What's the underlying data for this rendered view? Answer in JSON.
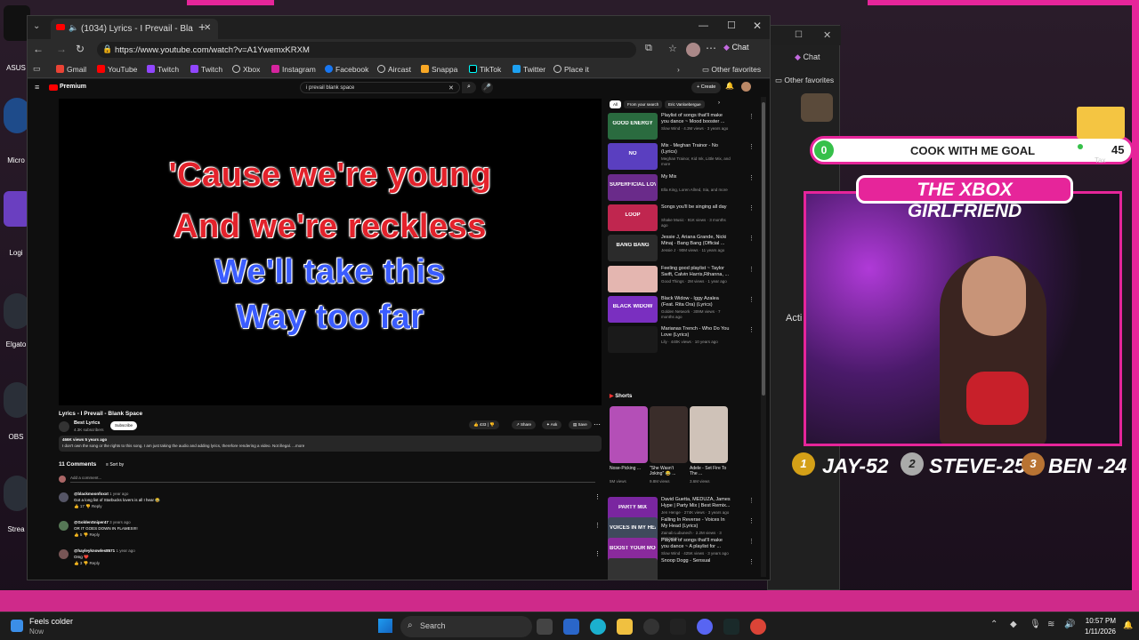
{
  "browser": {
    "tab_title": "(1034) Lyrics - I Prevail - Bla",
    "url": "https://www.youtube.com/watch?v=A1YwemxKRXM",
    "chat_label": "Chat",
    "bookmarks": [
      "Gmail",
      "YouTube",
      "Twitch",
      "Twitch",
      "Xbox",
      "Instagram",
      "Facebook",
      "Aircast",
      "Snappa",
      "TikTok",
      "Twitter",
      "Place it"
    ],
    "other_favorites": "Other favorites"
  },
  "back_window": {
    "chat_label": "Chat",
    "other_favorites": "Other favorites",
    "partial_text": "Acti"
  },
  "youtube": {
    "brand": "Premium",
    "search_query": "i prevail blank space",
    "create_label": "Create",
    "lyrics": [
      "'Cause we're young",
      "And we're reckless",
      "We'll take this",
      "Way too far"
    ],
    "video_title": "Lyrics - I Prevail - Blank Space",
    "channel": "Best Lyrics",
    "subscribers": "4.3K subscribers",
    "subscribe_label": "Subscribe",
    "likes": "433",
    "share_label": "Share",
    "ask_label": "Ask",
    "save_label": "Save",
    "views_meta": "466K views 5 years ago",
    "description": "I don't own the song or the rights to this song. I am just taking the audio and adding lyrics, therefore rendering a video. Not illegal. ...more",
    "comments_count": "11 Comments",
    "sort_label": "Sort by",
    "add_comment": "Add a comment...",
    "comments": [
      {
        "author": "@blackmoonfoxxt",
        "time": "1 year ago",
        "text": "Got a long list of Starbucks lovers is all I hear 😂",
        "likes": "17",
        "reply": "Reply"
      },
      {
        "author": "@GoldenSniper47",
        "time": "3 years ago",
        "text": "OR IT GOES DOWN IN FLAMES!!!!",
        "likes": "5",
        "reply": "Reply"
      },
      {
        "author": "@hayleyknowles8571",
        "time": "1 year ago",
        "text": "Omg ❤️",
        "likes": "3",
        "reply": "Reply"
      }
    ],
    "chips": [
      "All",
      "From your search",
      "Eric Vanloebergue"
    ],
    "recs": [
      {
        "title": "Playlist of songs that'll make you dance ~ Mood booster ...",
        "sub": "Slow Wind · 4.3M views · 3 years ago",
        "thumb_text": "GOOD ENERGY",
        "color": "#2a6b3f"
      },
      {
        "title": "Mix - Meghan Trainor - No (Lyrics)",
        "sub": "Meghan Trainor, Kid Ink, Little Mix, and more",
        "thumb_text": "NO",
        "color": "#5a3fc0"
      },
      {
        "title": "My Mix",
        "sub": "Ella King, Loren Allred, Sia, and more",
        "thumb_text": "SUPERFICIAL LOVE",
        "color": "#6a2b8a"
      },
      {
        "title": "Songs you'll be singing all day",
        "sub": "Shake Music · 91K views · 3 months ago",
        "thumb_text": "LOOP",
        "color": "#c0264f"
      },
      {
        "title": "Jessie J, Ariana Grande, Nicki Minaj - Bang Bang (Official ...",
        "sub": "Jessie J · 90M views · 11 years ago",
        "thumb_text": "BANG BANG",
        "color": "#2b2b2b"
      },
      {
        "title": "Feeling good playlist ~ Taylor Swift, Calvin Harris,Rihanna, ...",
        "sub": "Good Things · 2M views · 1 year ago",
        "thumb_text": "",
        "color": "#e4b6b0"
      },
      {
        "title": "Black Widow - Iggy Azalea (Feat. Rita Ora) (Lyrics)",
        "sub": "Golden Network · 309M views · 7 months ago",
        "thumb_text": "BLACK WIDOW",
        "color": "#7a2fc0"
      },
      {
        "title": "Marianas Trench - Who Do You Love (Lyrics)",
        "sub": "Lily · 440K views · 10 years ago",
        "thumb_text": "",
        "color": "#1a1a1a"
      }
    ],
    "shorts_label": "Shorts",
    "shorts": [
      {
        "title": "Nose-Picking ...",
        "sub": "5M views",
        "color": "#b44fb7"
      },
      {
        "title": "\"She Wasn't Joking\" 😂 ...",
        "sub": "9.8M views",
        "color": "#3a2d2a"
      },
      {
        "title": "Adele - Set Fire To The ...",
        "sub": "3.6M views",
        "color": "#cfc2b8"
      }
    ],
    "recs2": [
      {
        "title": "David Guetta, MEDUZA, James Hype | Party Mix | Best Remix...",
        "sub": "Jen Henge · 274K views · 3 years ago",
        "thumb_text": "PARTY MIX",
        "color": "#7a26a0"
      },
      {
        "title": "Falling In Reverse - Voices In My Head (Lyrics)",
        "sub": "Zainab Lubunech · 2.2M views · 3 years ago",
        "thumb_text": "VOICES IN MY HEAD",
        "color": "#3f4a5c"
      },
      {
        "title": "Playlist of songs that'll make you dance ~ A playlist for ...",
        "sub": "Slow Wind · 425K views · 3 years ago",
        "thumb_text": "BOOST YOUR MOOD",
        "color": "#8a2a9c"
      },
      {
        "title": "Snoop Dogg - Sensual",
        "sub": "",
        "thumb_text": "",
        "color": "#333"
      }
    ]
  },
  "overlay": {
    "goal_current": "0",
    "goal_label": "COOK WITH ME GOAL",
    "goal_target": "45",
    "tax_label": "Tax",
    "title": "THE XBOX GIRLFRIEND",
    "leaderboard": [
      "JAY-52",
      "STEVE-25",
      "BEN -24"
    ],
    "ranks": [
      "1",
      "2",
      "3"
    ]
  },
  "desktop": {
    "labels": [
      "Micro",
      "Logi",
      "Elgato",
      "OBS",
      "Strea",
      "ASUS"
    ]
  },
  "taskbar": {
    "weather_title": "Feels colder",
    "weather_sub": "Now",
    "search_placeholder": "Search",
    "time": "10:57 PM",
    "date": "1/11/2026"
  }
}
